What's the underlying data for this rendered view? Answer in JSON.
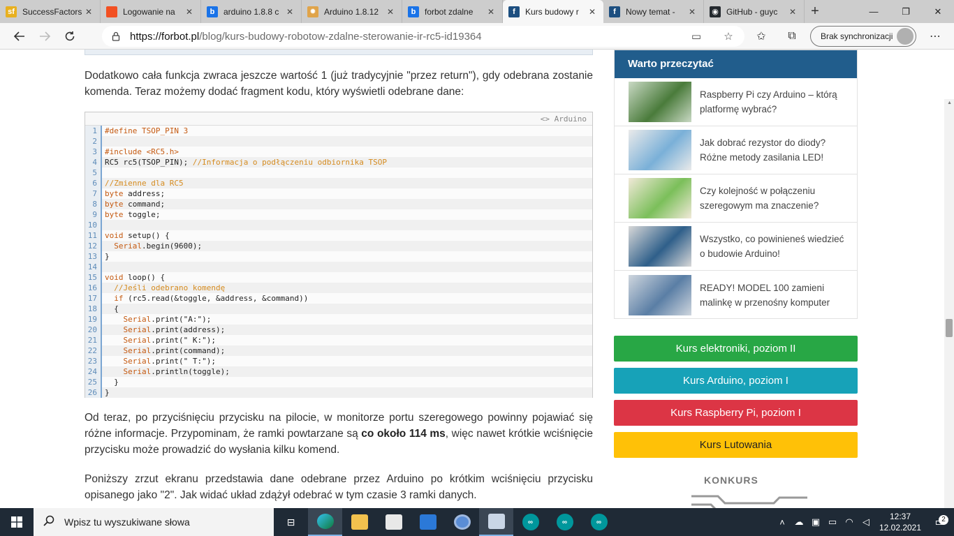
{
  "tabs": [
    {
      "label": "SuccessFactors",
      "favicon_text": "sf",
      "favicon_color": "#e8b020"
    },
    {
      "label": "Logowanie na",
      "favicon_text": "",
      "favicon_color": "#f25022"
    },
    {
      "label": "arduino 1.8.8 c",
      "favicon_text": "b",
      "favicon_color": "#1a73e8"
    },
    {
      "label": "Arduino 1.8.12",
      "favicon_text": "✹",
      "favicon_color": "#e0a44a"
    },
    {
      "label": "forbot zdalne",
      "favicon_text": "b",
      "favicon_color": "#1a73e8"
    },
    {
      "label": "Kurs budowy r",
      "favicon_text": "f",
      "favicon_color": "#1d4f80"
    },
    {
      "label": "Nowy temat -",
      "favicon_text": "f",
      "favicon_color": "#1d4f80"
    },
    {
      "label": "GitHub - guyc",
      "favicon_text": "◉",
      "favicon_color": "#24292e"
    }
  ],
  "address": {
    "host": "https://forbot.pl",
    "path": "/blog/kurs-budowy-robotow-zdalne-sterowanie-ir-rc5-id19364"
  },
  "sync_label": "Brak synchronizacji",
  "article": {
    "para1": "Dodatkowo cała funkcja zwraca jeszcze wartość 1 (już tradycyjnie \"przez return\"), gdy odebrana zostanie komenda. Teraz możemy dodać fragment kodu, który wyświetli odebrane dane:",
    "code_lang": "<> Arduino",
    "para2_a": "Od teraz, po przyciśnięciu przycisku na pilocie, w monitorze portu szeregowego powinny pojawiać się różne informacje. Przypominam, że ramki powtarzane są ",
    "para2_bold": "co około 114 ms",
    "para2_b": ", więc nawet krótkie wciśnięcie przycisku może prowadzić do wysłania kilku komend.",
    "para3": "Poniższy zrzut ekranu przedstawia dane odebrane przez Arduino po krótkim wciśnięciu przycisku opisanego jako \"2\". Jak widać układ zdążył odebrać w tym czasie 3 ramki danych."
  },
  "code_lines": [
    "#define TSOP_PIN 3",
    "",
    "#include <RC5.h>",
    "RC5 rc5(TSOP_PIN); //Informacja o podłączeniu odbiornika TSOP",
    "",
    "//Zmienne dla RC5",
    "byte address;",
    "byte command;",
    "byte toggle;",
    "",
    "void setup() {",
    "  Serial.begin(9600);",
    "}",
    "",
    "void loop() {",
    "  //Jeśli odebrano komendę",
    "  if (rc5.read(&toggle, &address, &command))",
    "  {",
    "    Serial.print(\"A:\");",
    "    Serial.print(address);",
    "    Serial.print(\" K:\");",
    "    Serial.print(command);",
    "    Serial.print(\" T:\");",
    "    Serial.println(toggle);",
    "  }",
    "}"
  ],
  "sidebar": {
    "title": "Warto przeczytać",
    "items": [
      {
        "label": "Raspberry Pi czy Arduino – którą platformę wybrać?"
      },
      {
        "label": "Jak dobrać rezystor do diody? Różne metody zasilania LED!"
      },
      {
        "label": "Czy kolejność w połączeniu szeregowym ma znaczenie?"
      },
      {
        "label": "Wszystko, co powinieneś wiedzieć o budowie Arduino!"
      },
      {
        "label": "READY! MODEL 100 zamieni malinkę w przenośny komputer"
      }
    ],
    "buttons": [
      {
        "label": "Kurs elektroniki, poziom II",
        "color": "#28a745"
      },
      {
        "label": "Kurs Arduino, poziom I",
        "color": "#17a2b8"
      },
      {
        "label": "Kurs Raspberry Pi, poziom I",
        "color": "#dc3545"
      },
      {
        "label": "Kurs Lutowania",
        "color": "#ffc107"
      }
    ],
    "konkurs": "KONKURS"
  },
  "taskbar": {
    "search_placeholder": "Wpisz tu wyszukiwane słowa",
    "time": "12:37",
    "date": "12.02.2021",
    "notifications": "2"
  }
}
